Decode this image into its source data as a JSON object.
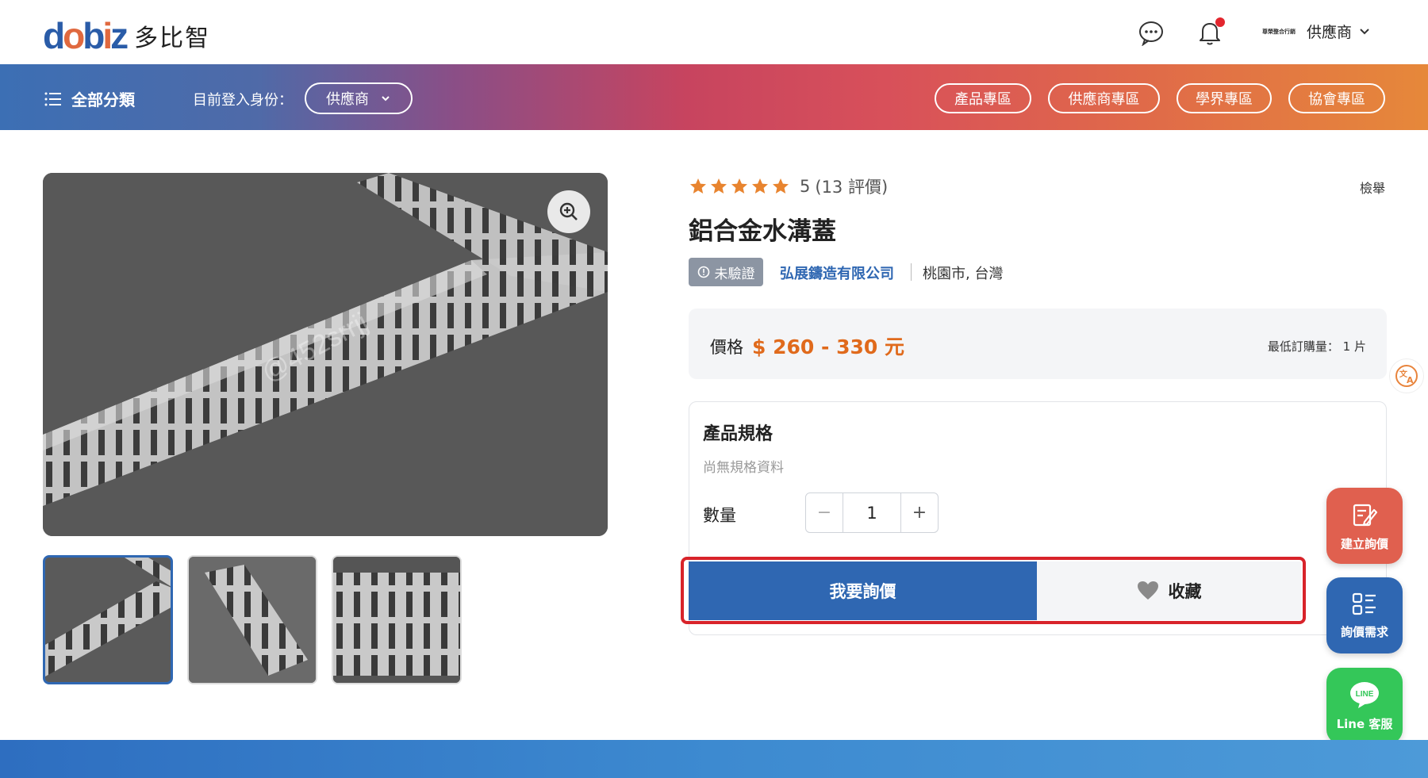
{
  "brand": {
    "logo_text": "多比智"
  },
  "header": {
    "user_company_logo_text": "尊榮整合行銷",
    "user_role": "供應商"
  },
  "nav": {
    "all_categories": "全部分類",
    "login_as_label": "目前登入身份：",
    "role_selected": "供應商",
    "links": [
      "產品專區",
      "供應商專區",
      "學界專區",
      "協會專區"
    ]
  },
  "product": {
    "rating_value": "5",
    "rating_count": "(13 評價)",
    "report_label": "檢舉",
    "title": "鋁合金水溝蓋",
    "verify_status": "未驗證",
    "company": "弘展鑄造有限公司",
    "location": "桃園市, 台灣",
    "price_label": "價格",
    "price": "$ 260 - 330 元",
    "moq": "最低訂購量： 1 片",
    "spec_title": "產品規格",
    "spec_empty": "尚無規格資料",
    "qty_label": "數量",
    "qty_value": "1",
    "inquire_label": "我要詢價",
    "favorite_label": "收藏",
    "image_watermark": "@452srrjj"
  },
  "floating": {
    "create_inquiry": "建立詢價",
    "inquiry_needs": "詢價需求",
    "line_support": "Line 客服",
    "line_badge": "LINE"
  },
  "colors": {
    "primary_blue": "#2f67b2",
    "price_orange": "#e06a1c",
    "highlight_red": "#d8232a",
    "create_inquiry_bg": "#e0604f",
    "inquiry_needs_bg": "#2f67b2",
    "line_bg": "#34c759"
  },
  "icons": [
    "chat-icon",
    "bell-icon",
    "chevron-down-icon",
    "list-icon",
    "zoom-in-icon",
    "star-icon",
    "alert-circle-icon",
    "heart-icon",
    "translate-icon",
    "edit-note-icon",
    "list-detail-icon",
    "line-chat-icon"
  ]
}
